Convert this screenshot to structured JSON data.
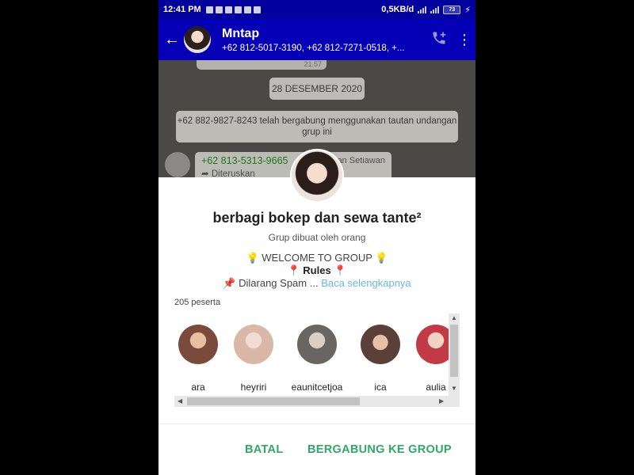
{
  "status_bar": {
    "time": "12:41 PM",
    "speed": "0,5KB/d",
    "battery": "73"
  },
  "header": {
    "title": "Mntap",
    "subtitle": "+62 812-5017-3190, +62 812-7271-0518, +...",
    "back_icon": "arrow-left-icon",
    "call_icon": "call-add-icon",
    "menu_icon": "more-vertical-icon"
  },
  "chat": {
    "prev_time": "21.57",
    "date_chip": "28 DESEMBER 2020",
    "system_message": "+62 882-9827-8243 telah bergabung menggunakan tautan undangan grup ini",
    "message": {
      "sender": "+62 813-5313-9665",
      "pushname": "~ Ian Setiawan",
      "forwarded": "Diteruskan"
    }
  },
  "dialog": {
    "group_name": "berbagi bokep dan sewa tante²",
    "creator": "Grup dibuat oleh orang",
    "desc_line1": "💡 WELCOME TO GROUP 💡",
    "desc_line2_pin": "📍",
    "desc_line2_bold": "Rules",
    "desc_line3": "📌 Dilarang Spam ...",
    "read_more": "Baca selengkapnya",
    "participants_count": "205 peserta",
    "participants": [
      {
        "name": "ara",
        "color": "#7a4b3a"
      },
      {
        "name": "heyriri",
        "color": "#d9b8a8"
      },
      {
        "name": "eaunitcetjoa",
        "color": "#6a6560"
      },
      {
        "name": "ica",
        "color": "#5a4038"
      },
      {
        "name": "aulia",
        "color": "#c23a45"
      }
    ],
    "cancel_label": "BATAL",
    "join_label": "BERGABUNG KE GROUP",
    "accent_color": "#2fa86a"
  }
}
